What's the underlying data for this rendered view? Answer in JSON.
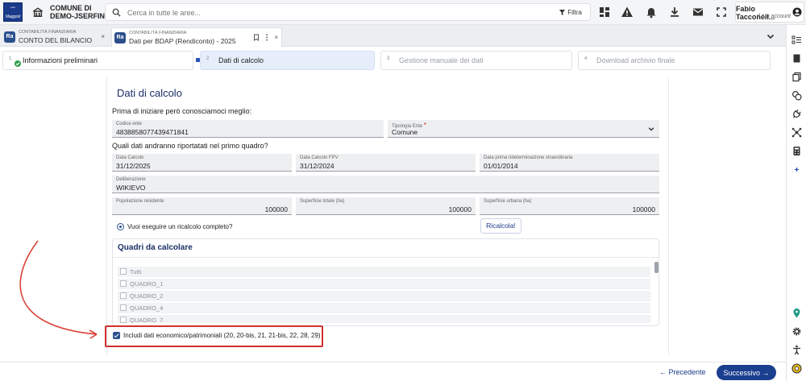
{
  "header": {
    "logo_top": "ente",
    "logo_bottom": "Maggioli",
    "ente_line1": "COMUNE DI",
    "ente_line2": "DEMO-JSERFIN",
    "search_placeholder": "Cerca in tutte le aree...",
    "filter_label": "Filtra",
    "user_name": "Fabio Tacconell...",
    "user_account": "Il tuo account"
  },
  "tabs": [
    {
      "badge": "Ra",
      "category": "CONTABILITÀ FINANZIARIA",
      "title": "CONTO DEL BILANCIO",
      "close": "×"
    },
    {
      "badge": "Ra",
      "category": "CONTABILITÀ FINANZIARIA",
      "title": "Dati per BDAP (Rendiconto) - 2025",
      "close": "×"
    }
  ],
  "steps": [
    {
      "num": "1",
      "label": "Informazioni preliminari",
      "state": "done"
    },
    {
      "num": "2",
      "label": "Dati di calcolo",
      "state": "active"
    },
    {
      "num": "3",
      "label": "Gestione manuale dei dati",
      "state": "disabled"
    },
    {
      "num": "4",
      "label": "Download archivio finale",
      "state": "disabled"
    }
  ],
  "form": {
    "title": "Dati di calcolo",
    "intro": "Prima di iniziare però conosciamoci meglio:",
    "codice_ente": {
      "label": "Codice ente",
      "value": "4838858077439471841"
    },
    "tipologia_ente": {
      "label": "Tipologia Ente",
      "required": "*",
      "value": "Comune"
    },
    "question": "Quali dati andranno riportatati nel primo quadro?",
    "data_calcolo": {
      "label": "Data Calcolo",
      "value": "31/12/2025"
    },
    "data_calcolo_fpv": {
      "label": "Data Calcolo FPV",
      "value": "31/12/2024"
    },
    "data_prima": {
      "label": "Data prima rideterminazione straordinaria",
      "value": "01/01/2014"
    },
    "deliberazione": {
      "label": "Deliberazione",
      "value": "WIKIEVO"
    },
    "popolazione": {
      "label": "Popolazione residente",
      "value": "100000"
    },
    "superficie_totale": {
      "label": "Superficie totale (ha)",
      "value": "100000"
    },
    "superficie_urbana": {
      "label": "Superficie urbana (ha)",
      "value": "100000"
    },
    "ricalcolo_label": "Vuoi eseguire un ricalcolo completo?",
    "ricalcola_button": "Ricalcola!"
  },
  "quadri": {
    "title": "Quadri da calcolare",
    "items": [
      "Tutti",
      "QUADRO_1",
      "QUADRO_2",
      "QUADRO_4",
      "QUADRO_7"
    ]
  },
  "include_economic": {
    "label": "Includi dati economico/patrimoniali (20, 20-bis, 21, 21-bis, 22, 28, 29)",
    "checked": true
  },
  "footer": {
    "prev_label": "Precedente",
    "next_label": "Successivo"
  },
  "colors": {
    "primary": "#1b3f8f",
    "highlight": "#d32f2f",
    "active_step": "#e6eefb"
  }
}
